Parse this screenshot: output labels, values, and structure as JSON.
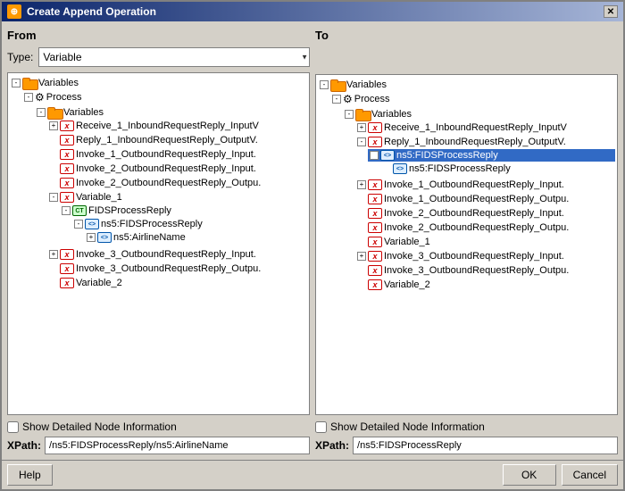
{
  "dialog": {
    "title": "Create Append Operation",
    "title_icon": "⊕",
    "close_label": "✕"
  },
  "from_panel": {
    "header": "From",
    "type_label": "Type:",
    "type_value": "Variable",
    "type_options": [
      "Variable"
    ],
    "tree": {
      "root": {
        "label": "Variables",
        "icon": "folder",
        "expanded": true,
        "children": [
          {
            "label": "Process",
            "icon": "process",
            "expanded": true,
            "children": [
              {
                "label": "Variables",
                "icon": "folder",
                "expanded": true,
                "children": [
                  {
                    "label": "Receive_1_InboundRequestReply_InputV",
                    "icon": "var",
                    "expanded": true,
                    "children": []
                  },
                  {
                    "label": "Reply_1_InboundRequestReply_OutputV.",
                    "icon": "var",
                    "expanded": false,
                    "children": []
                  },
                  {
                    "label": "Invoke_1_OutboundRequestReply_Input.",
                    "icon": "var",
                    "expanded": false,
                    "children": []
                  },
                  {
                    "label": "Invoke_2_OutboundRequestReply_Input.",
                    "icon": "var",
                    "expanded": false,
                    "children": []
                  },
                  {
                    "label": "Invoke_2_OutboundRequestReply_Outpu.",
                    "icon": "var",
                    "expanded": false,
                    "children": []
                  },
                  {
                    "label": "Variable_1",
                    "icon": "var",
                    "expanded": true,
                    "children": [
                      {
                        "label": "FIDSProcessReply",
                        "icon": "complex",
                        "expanded": true,
                        "children": [
                          {
                            "label": "ns5:FIDSProcessReply",
                            "icon": "elem",
                            "expanded": true,
                            "children": [
                              {
                                "label": "ns5:AirlineName",
                                "icon": "elem",
                                "expanded": false,
                                "selected": false,
                                "children": []
                              }
                            ]
                          }
                        ]
                      }
                    ]
                  },
                  {
                    "label": "Invoke_3_OutboundRequestReply_Input.",
                    "icon": "var",
                    "expanded": false,
                    "children": []
                  },
                  {
                    "label": "Invoke_3_OutboundRequestReply_Outpu.",
                    "icon": "var",
                    "expanded": false,
                    "children": []
                  },
                  {
                    "label": "Variable_2",
                    "icon": "var",
                    "expanded": false,
                    "children": []
                  }
                ]
              }
            ]
          }
        ]
      }
    },
    "show_detail_label": "Show Detailed Node Information",
    "xpath_label": "XPath:",
    "xpath_value": "/ns5:FIDSProcessReply/ns5:AirlineName"
  },
  "to_panel": {
    "header": "To",
    "tree": {
      "root": {
        "label": "Variables",
        "icon": "folder",
        "expanded": true,
        "children": [
          {
            "label": "Process",
            "icon": "process",
            "expanded": true,
            "children": [
              {
                "label": "Variables",
                "icon": "folder",
                "expanded": true,
                "children": [
                  {
                    "label": "Receive_1_InboundRequestReply_InputV",
                    "icon": "var",
                    "expanded": false,
                    "children": []
                  },
                  {
                    "label": "Reply_1_InboundRequestReply_OutputV.",
                    "icon": "var",
                    "expanded": true,
                    "children": [
                      {
                        "label": "FIDSProcessReply",
                        "icon": "complex",
                        "expanded": true,
                        "selected": true,
                        "children": [
                          {
                            "label": "ns5:FIDSProcessReply",
                            "icon": "elem",
                            "expanded": false,
                            "children": []
                          }
                        ]
                      }
                    ]
                  },
                  {
                    "label": "Invoke_1_OutboundRequestReply_Input.",
                    "icon": "var",
                    "expanded": false,
                    "children": []
                  },
                  {
                    "label": "Invoke_1_OutboundRequestReply_Outpu.",
                    "icon": "var",
                    "expanded": false,
                    "children": []
                  },
                  {
                    "label": "Invoke_2_OutboundRequestReply_Input.",
                    "icon": "var",
                    "expanded": false,
                    "children": []
                  },
                  {
                    "label": "Invoke_2_OutboundRequestReply_Outpu.",
                    "icon": "var",
                    "expanded": false,
                    "children": []
                  },
                  {
                    "label": "Variable_1",
                    "icon": "var",
                    "expanded": false,
                    "children": []
                  },
                  {
                    "label": "Invoke_3_OutboundRequestReply_Input.",
                    "icon": "var",
                    "expanded": false,
                    "children": []
                  },
                  {
                    "label": "Invoke_3_OutboundRequestReply_Outpu.",
                    "icon": "var",
                    "expanded": false,
                    "children": []
                  },
                  {
                    "label": "Variable_2",
                    "icon": "var",
                    "expanded": false,
                    "children": []
                  }
                ]
              }
            ]
          }
        ]
      }
    },
    "show_detail_label": "Show Detailed Node Information",
    "xpath_label": "XPath:",
    "xpath_value": "/ns5:FIDSProcessReply"
  },
  "buttons": {
    "help": "Help",
    "ok": "OK",
    "cancel": "Cancel"
  }
}
